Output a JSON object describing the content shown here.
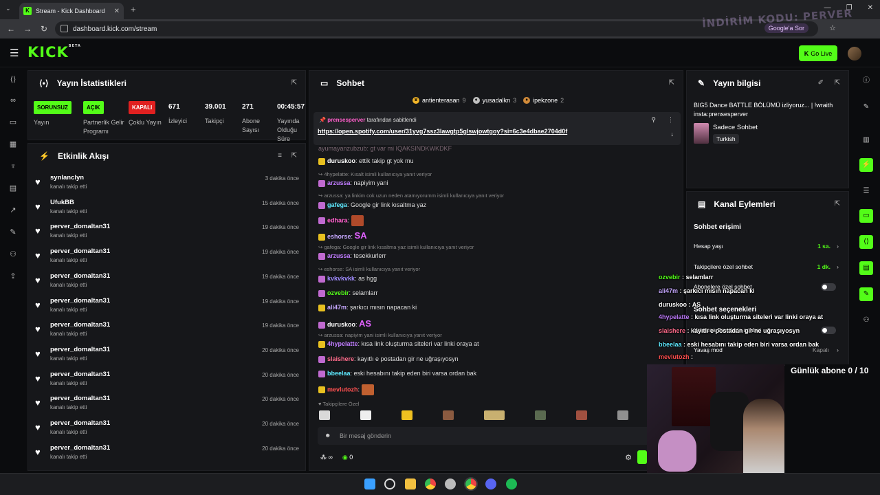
{
  "browser": {
    "tab_title": "Stream - Kick Dashboard",
    "url": "dashboard.kick.com/stream",
    "ask_google": "Google'a Sor",
    "promo_text": "İNDİRİM KODU: PERVER"
  },
  "topbar": {
    "logo": "KICK",
    "logo_sup": "BETA",
    "go_live": "Go Live"
  },
  "stats": {
    "title": "Yayın İstatistikleri",
    "items": [
      {
        "badge": "SORUNSUZ",
        "label": "Yayın"
      },
      {
        "badge": "AÇIK",
        "label": "Partnerlik Gelir Programı"
      },
      {
        "badge": "KAPALI",
        "label": "Çoklu Yayın"
      },
      {
        "value": "671",
        "label": "İzleyici"
      },
      {
        "value": "39.001",
        "label": "Takipçi"
      },
      {
        "value": "271",
        "label": "Abone Sayısı"
      },
      {
        "value": "00:45:57",
        "label": "Yayında Olduğu Süre"
      }
    ]
  },
  "activity": {
    "title": "Etkinlik Akışı",
    "events": [
      {
        "user": "synlanclyn",
        "action": "kanalı takip etti",
        "time": "3 dakika önce"
      },
      {
        "user": "UfukBB",
        "action": "kanalı takip etti",
        "time": "15 dakika önce"
      },
      {
        "user": "perver_domaltan31",
        "action": "kanalı takip etti",
        "time": "19 dakika önce"
      },
      {
        "user": "perver_domaltan31",
        "action": "kanalı takip etti",
        "time": "19 dakika önce"
      },
      {
        "user": "perver_domaltan31",
        "action": "kanalı takip etti",
        "time": "19 dakika önce"
      },
      {
        "user": "perver_domaltan31",
        "action": "kanalı takip etti",
        "time": "19 dakika önce"
      },
      {
        "user": "perver_domaltan31",
        "action": "kanalı takip etti",
        "time": "19 dakika önce"
      },
      {
        "user": "perver_domaltan31",
        "action": "kanalı takip etti",
        "time": "20 dakika önce"
      },
      {
        "user": "perver_domaltan31",
        "action": "kanalı takip etti",
        "time": "20 dakika önce"
      },
      {
        "user": "perver_domaltan31",
        "action": "kanalı takip etti",
        "time": "20 dakika önce"
      },
      {
        "user": "perver_domaltan31",
        "action": "kanalı takip etti",
        "time": "20 dakika önce"
      },
      {
        "user": "perver_domaltan31",
        "action": "kanalı takip etti",
        "time": "20 dakika önce"
      }
    ]
  },
  "chat": {
    "title": "Sohbet",
    "leaders": [
      {
        "name": "antienterasan",
        "count": "9"
      },
      {
        "name": "yusadalkn",
        "count": "3"
      },
      {
        "name": "ipekzone",
        "count": "2"
      }
    ],
    "pinned_by_user": "prensesperver",
    "pinned_by_text": "tarafından sabitlendi",
    "pinned_link": "https://open.spotify.com/user/31yvg7ssz3lawgtp5glswjowtgoy?si=6c3e4dbae2704d0f",
    "clipped_top": "ayumayanzubzub: gt var mi IQAKSINDKWKDKF",
    "lines": [
      {
        "kind": "msg",
        "user": "duruskoo",
        "color": "#ffffff",
        "text": "ettik takip gt yok mu"
      },
      {
        "kind": "reply",
        "text": "4hypelatte: Kısalt isimli kullanıcıya yanıt veriyor"
      },
      {
        "kind": "msg",
        "user": "arzussa",
        "color": "#c07cff",
        "text": "napiyim yani"
      },
      {
        "kind": "reply",
        "text": "arzussa: ya linkim cok uzun neden atamıyorumm isimli kullanıcıya yanıt veriyor"
      },
      {
        "kind": "msg",
        "user": "gafega",
        "color": "#5eeaff",
        "text": "Google gir link kısaltma yaz"
      },
      {
        "kind": "msg",
        "user": "edhara",
        "color": "#ff5ecb",
        "text": ""
      },
      {
        "kind": "msg",
        "user": "eshorse",
        "color": "#c6a8ff",
        "text": "SA"
      },
      {
        "kind": "reply",
        "text": "gafega: Google gir link kısaltma yaz isimli kullanıcıya yanıt veriyor"
      },
      {
        "kind": "msg",
        "user": "arzussa",
        "color": "#c07cff",
        "text": "tesekkurlerr"
      },
      {
        "kind": "reply",
        "text": "eshorse: SA isimli kullanıcıya yanıt veriyor"
      },
      {
        "kind": "msg",
        "user": "kvkvkvkk",
        "color": "#a08bff",
        "text": "as hgg"
      },
      {
        "kind": "msg",
        "user": "ozvebir",
        "color": "#53fc18",
        "text": "selamlarr"
      },
      {
        "kind": "msg",
        "user": "ali47m",
        "color": "#c6a8ff",
        "text": "şarkıcı mısın napacan ki"
      },
      {
        "kind": "msg",
        "user": "duruskoo",
        "color": "#ffffff",
        "text": "AS"
      },
      {
        "kind": "reply",
        "text": "arzussa: napiyim yani isimli kullanıcıya yanıt veriyor"
      },
      {
        "kind": "msg",
        "user": "4hypelatte",
        "color": "#c07cff",
        "text": "kısa link oluşturma siteleri var linki oraya at"
      },
      {
        "kind": "msg",
        "user": "slaishere",
        "color": "#ff6b8b",
        "text": "kayıtlı e postadan gir ne uğraşıyosyn"
      },
      {
        "kind": "msg",
        "user": "bbeelaa",
        "color": "#5eeaff",
        "text": "eski hesabını takip eden biri varsa ordan bak"
      },
      {
        "kind": "msg",
        "user": "mevlutozh",
        "color": "#ff5050",
        "text": ""
      }
    ],
    "followers_only": "Takipçilere Özel",
    "input_placeholder": "Bir mesaj gönderin",
    "foot_count": "0"
  },
  "info": {
    "title": "Yayın bilgisi",
    "stream_title": "BIG5 Dance BATTLE BÖLÜMÜ izliyoruz... | !wraith insta:prensesperver",
    "category": "Sadece Sohbet",
    "language": "Turkish"
  },
  "actions": {
    "title": "Kanal Eylemleri",
    "section1": "Sohbet erişimi",
    "rows": [
      {
        "label": "Hesap yaşı",
        "value": "1 sa."
      },
      {
        "label": "Takipçilere özel sohbet",
        "value": "1 dk."
      },
      {
        "label": "Abonelere özel sohbet",
        "value": ""
      }
    ],
    "section2": "Sohbet seçenekleri",
    "rows2": [
      {
        "label": "Yalnızca Emotlarla sohbet",
        "value": ""
      },
      {
        "label": "Yavaş mod",
        "value": "Kapalı"
      }
    ]
  },
  "overlay": {
    "lines": [
      {
        "user": "ozvebir",
        "color": "#53fc18",
        "text": "selamlarr"
      },
      {
        "user": "ali47m",
        "color": "#c6a8ff",
        "text": "şarkıcı mısın napacan ki"
      },
      {
        "user": "duruskoo",
        "color": "#ffffff",
        "text": "AS"
      },
      {
        "user": "4hypelatte",
        "color": "#c07cff",
        "text": "kısa link oluşturma siteleri var linki oraya at"
      },
      {
        "user": "slaishere",
        "color": "#ff6b8b",
        "text": "kayıtlı e postadan gir ne uğraşıyosyn"
      },
      {
        "user": "bbeelaa",
        "color": "#5eeaff",
        "text": "eski hesabını takip eden biri varsa ordan bak"
      },
      {
        "user": "mevlutozh",
        "color": "#ff5050",
        "text": ""
      }
    ],
    "sub_goal": "Günlük abone 0 / 10"
  },
  "colors": {
    "accent": "#53fc18",
    "panel": "#16171a",
    "danger": "#e02020"
  }
}
